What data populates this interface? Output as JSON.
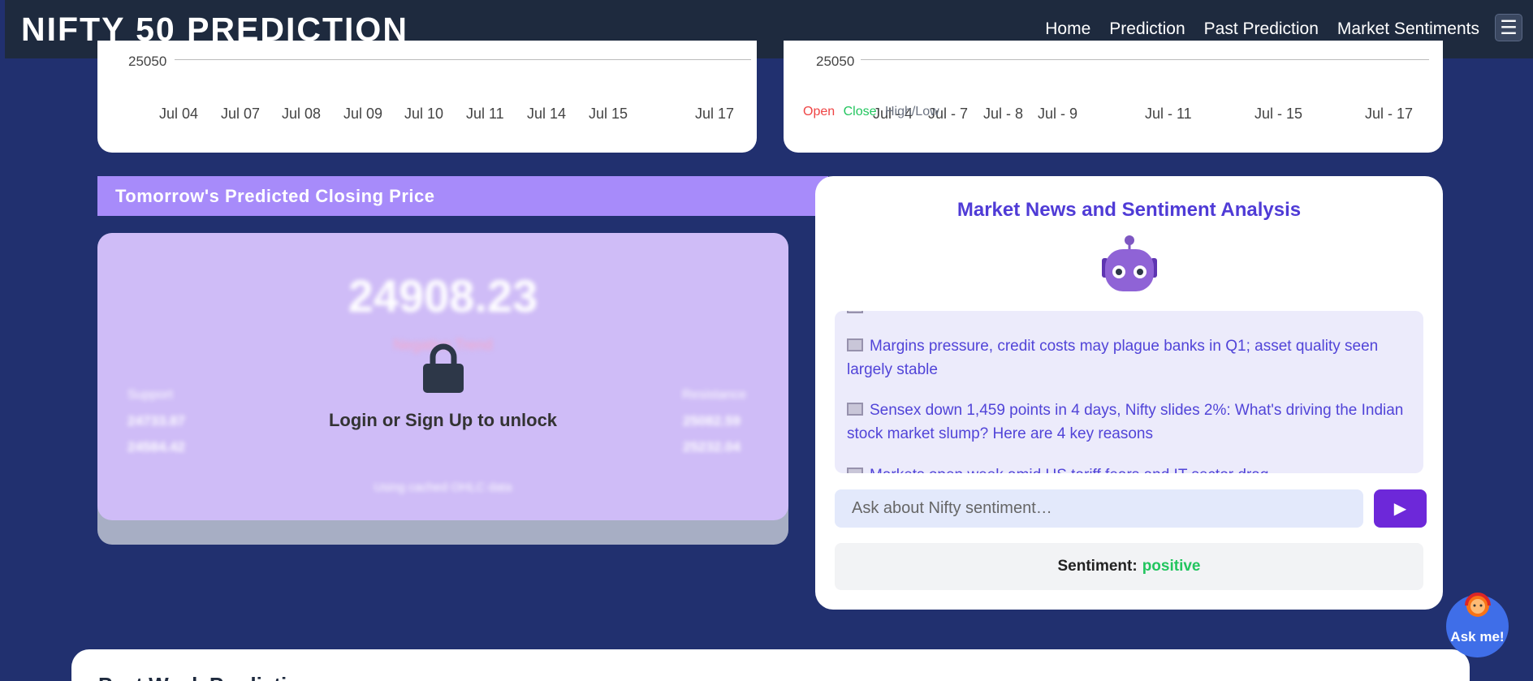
{
  "navbar": {
    "brand": "NIFTY 50 PREDICTION",
    "links": [
      "Home",
      "Prediction",
      "Past Prediction",
      "Market Sentiments"
    ],
    "menu_icon": "hamburger-icon"
  },
  "chart_left": {
    "y_tick": "25050",
    "x_ticks": [
      "Jul 04",
      "Jul 07",
      "Jul 08",
      "Jul 09",
      "Jul 10",
      "Jul 11",
      "Jul 14",
      "Jul 15",
      "Jul 17"
    ]
  },
  "chart_right": {
    "y_tick": "25050",
    "x_ticks": [
      "Jul - 4",
      "Jul - 7",
      "Jul - 8",
      "Jul - 9",
      "Jul - 11",
      "Jul - 15",
      "Jul - 17"
    ],
    "legend": {
      "open": "Open",
      "close": "Close",
      "highlow": "High/Low"
    },
    "colors": {
      "open": "#ef4444",
      "close": "#22c55e",
      "highlow": "#6b7280"
    }
  },
  "prediction": {
    "header": "Tomorrow's Predicted Closing Price",
    "value": "24908.23",
    "trend": "Negative Trend",
    "support_label": "Support",
    "support_values": [
      "24733.87",
      "24584.42"
    ],
    "resistance_label": "Resistance",
    "resistance_values": [
      "25082.59",
      "25232.04"
    ],
    "cached_note": "Using cached OHLC data",
    "lock_text": "Login or Sign Up to unlock"
  },
  "news": {
    "title": "Market News and Sentiment Analysis",
    "items": [
      "Margins pressure, credit costs may plague banks in Q1; asset quality seen largely stable",
      "Sensex down 1,459 points in 4 days, Nifty slides 2%: What's driving the Indian stock market slump? Here are 4 key reasons",
      "Markets open week amid US tariff fears and IT sector drag"
    ],
    "chat_placeholder": "Ask about Nifty sentiment…",
    "send_icon": "play-icon",
    "sentiment_label": "Sentiment:",
    "sentiment_value": "positive"
  },
  "bottom": {
    "title": "Past Week Prediction"
  },
  "askme": {
    "label": "Ask me!"
  }
}
